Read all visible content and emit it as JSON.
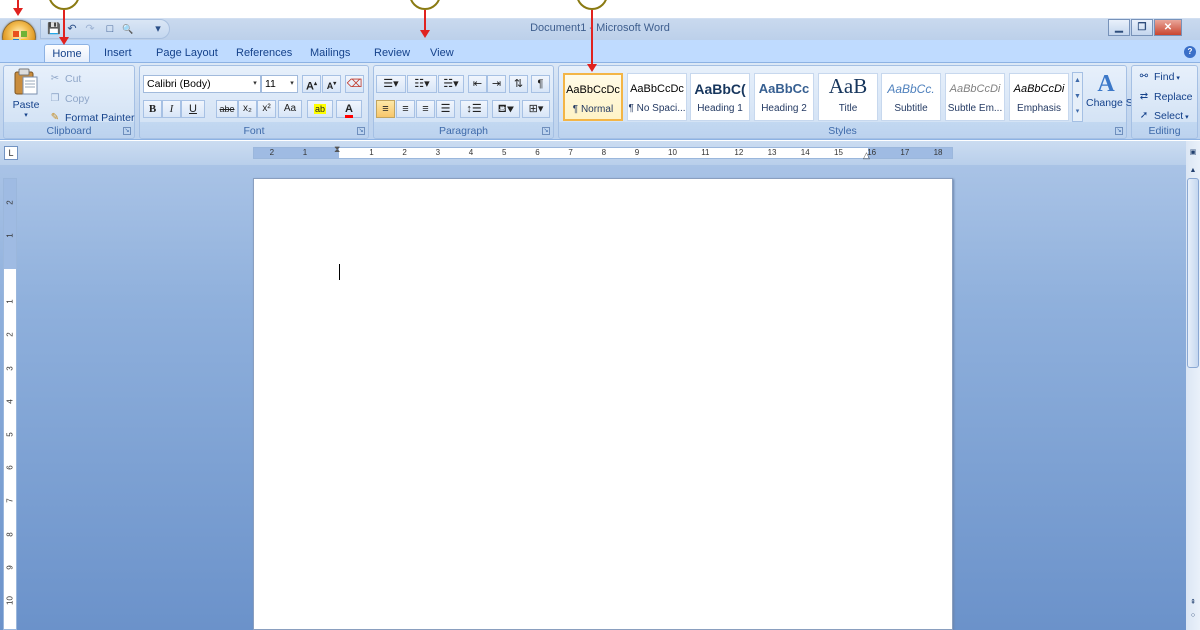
{
  "window": {
    "title": "Document1 - Microsoft Word",
    "minimize": "▁",
    "restore": "❐",
    "close": "✕"
  },
  "qat": {
    "save": "💾",
    "undo": "↶",
    "redo": "↷",
    "new": "□",
    "preview": "🔍",
    "customize": "▾"
  },
  "tabs": [
    "Home",
    "Insert",
    "Page Layout",
    "References",
    "Mailings",
    "Review",
    "View"
  ],
  "active_tab": "Home",
  "clipboard": {
    "label": "Clipboard",
    "paste": "Paste",
    "cut": "Cut",
    "copy": "Copy",
    "format_painter": "Format Painter"
  },
  "font": {
    "label": "Font",
    "name": "Calibri (Body)",
    "size": "11",
    "grow": "A",
    "shrink": "A",
    "bold": "B",
    "italic": "I",
    "underline": "U",
    "strike": "abe",
    "subscript": "x₂",
    "superscript": "x²",
    "change_case": "Aa",
    "highlight": "ab",
    "font_color": "A",
    "highlight_color": "#ffff00",
    "font_color_value": "#ff0000"
  },
  "paragraph": {
    "label": "Paragraph",
    "show_marks": "¶"
  },
  "styles": {
    "label": "Styles",
    "items": [
      {
        "sample": "AaBbCcDc",
        "name": "¶ Normal"
      },
      {
        "sample": "AaBbCcDc",
        "name": "¶ No Spaci..."
      },
      {
        "sample": "AaBbC(",
        "name": "Heading 1"
      },
      {
        "sample": "AaBbCc",
        "name": "Heading 2"
      },
      {
        "sample": "AaB",
        "name": "Title"
      },
      {
        "sample": "AaBbCc.",
        "name": "Subtitle"
      },
      {
        "sample": "AaBbCcDi",
        "name": "Subtle Em..."
      },
      {
        "sample": "AaBbCcDi",
        "name": "Emphasis"
      }
    ],
    "change_styles": "Change Styles"
  },
  "editing": {
    "label": "Editing",
    "find": "Find",
    "replace": "Replace",
    "select": "Select"
  },
  "ruler": {
    "ticks": [
      "2",
      "1",
      "1",
      "2",
      "3",
      "4",
      "5",
      "6",
      "7",
      "8",
      "9",
      "10",
      "11",
      "12",
      "13",
      "14",
      "15",
      "16",
      "17",
      "18"
    ],
    "vticks": [
      "2",
      "1",
      "1",
      "2",
      "3",
      "4",
      "5",
      "6",
      "7",
      "8",
      "9",
      "10"
    ]
  },
  "colors": {
    "ribbon_bg": "#c6d8ef",
    "workspace": "#6b92ca",
    "annotation": "#e0221f",
    "callout_ring": "#8a7a12"
  }
}
